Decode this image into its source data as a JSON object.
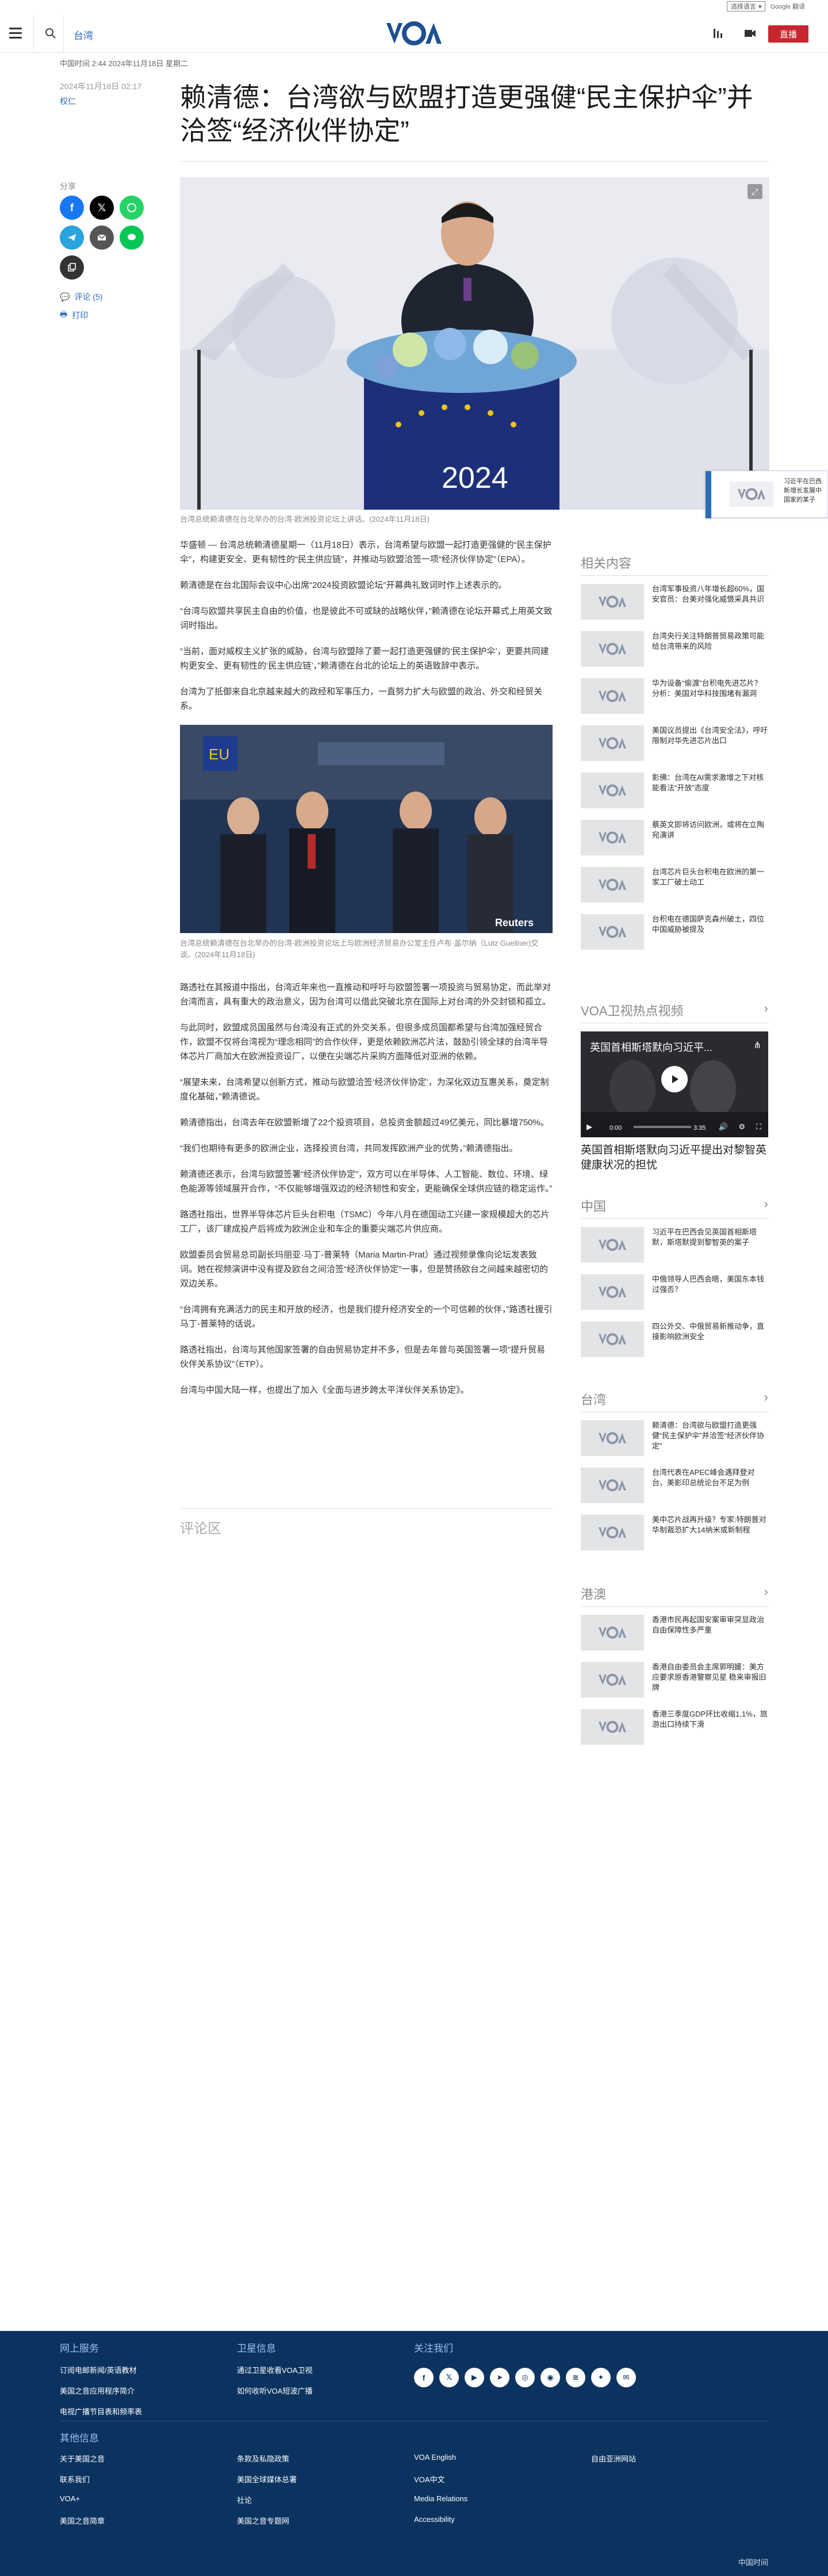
{
  "translate": {
    "select_label": "选择语言",
    "powered": "Google 翻译"
  },
  "header": {
    "section": "台湾",
    "live_label": "直播"
  },
  "article": {
    "dateline": "中国时间 2:44 2024年11月18日 星期二",
    "published": "2024年11月18日 02:17",
    "author": "权仁",
    "title": "赖清德：台湾欲与欧盟打造更强健“民主保护伞”并洽签“经济伙伴协定”",
    "hero_caption": "台湾总统赖清德在台北举办的台湾-欧洲投资论坛上讲话。(2024年11月18日)",
    "paragraphs_a": [
      "华盛顿 — 台湾总统赖清德星期一（11月18日）表示，台湾希望与欧盟一起打造更强健的“民主保护伞”，构建更安全、更有韧性的“民主供应链”，并推动与欧盟洽签一项“经济伙伴协定”（EPA）。",
      "赖清德是在台北国际会议中心出席“2024投资欧盟论坛”开幕典礼致词时作上述表示的。",
      "“台湾与欧盟共享民主自由的价值，也是彼此不可或缺的战略伙伴，”赖清德在论坛开幕式上用英文致词时指出。",
      "“当前，面对威权主义扩张的威胁，台湾与欧盟除了要一起打造更强健的‘民主保护伞’，更要共同建构更安全、更有韧性的‘民主供应链’，”赖清德在台北的论坛上的英语致辞中表示。",
      "台湾为了抵御来自北京越来越大的政经和军事压力，一直努力扩大与欧盟的政治、外交和经贸关系。"
    ],
    "inline_caption": "台湾总统赖清德在台北举办的台湾-欧洲投资论坛上与欧洲经济贸易办公室主任卢布·盖尔纳（Lutz Guellner)交谈。(2024年11月18日)",
    "paragraphs_b": [
      "路透社在其报道中指出，台湾近年来也一直推动和呼吁与欧盟签署一项投资与贸易协定，而此举对台湾而言，具有重大的政治意义，因为台湾可以借此突破北京在国际上对台湾的外交封锁和孤立。",
      "与此同时，欧盟成员国虽然与台湾没有正式的外交关系，但很多成员国都希望与台湾加强经贸合作，欧盟不仅将台湾视为“理念相同”的合作伙伴，更是依赖欧洲芯片法，鼓励引领全球的台湾半导体芯片厂商加大在欧洲投资设厂，以便在尖端芯片采购方面降低对亚洲的依赖。",
      "“展望未来，台湾希望以创新方式，推动与欧盟洽签‘经济伙伴协定’，为深化双边互惠关系，奠定制度化基础，”赖清德说。",
      "赖清德指出，台湾去年在欧盟新增了22个投资项目，总投资金额超过49亿美元，同比暴增750%。",
      "“我们也期待有更多的欧洲企业，选择投资台湾，共同发挥欧洲产业的优势，”赖清德指出。",
      "赖清德还表示，台湾与欧盟签署“经济伙伴协定”，双方可以在半导体、人工智能、数位、环境、绿色能源等领域展开合作，“不仅能够增强双边的经济韧性和安全，更能确保全球供应链的稳定运作。”",
      "路透社指出，世界半导体芯片巨头台积电（TSMC）今年八月在德国动工兴建一家规模超大的芯片工厂，该厂建成投产后将成为欧洲企业和车企的重要尖端芯片供应商。",
      "欧盟委员会贸易总司副长玛丽亚·马丁-普莱特（Maria Martin-Prat）通过视频录像向论坛发表致词。她在视频演讲中没有提及欧台之间洽签“经济伙伴协定”一事，但是赞扬欧台之间越来越密切的双边关系。",
      "“台湾拥有充满活力的民主和开放的经济，也是我们提升经济安全的一个可信赖的伙伴，”路透社援引马丁-普莱特的话说。",
      "路透社指出，台湾与其他国家签署的自由贸易协定并不多，但是去年曾与英国签署一项“提升贸易伙伴关系协议”（ETP）。",
      "台湾与中国大陆一样，也提出了加入《全面与进步跨太平洋伙伴关系协定》。"
    ],
    "comments_heading": "评论区"
  },
  "share": {
    "label": "分享",
    "comments_link": "评论 (5)",
    "print_link": "打印"
  },
  "widget": {
    "text": "习近平在巴西新增长发展中国家的某子"
  },
  "rail": {
    "related_heading": "相关内容",
    "related": [
      "台湾军事投资八年增长超60%，国安官员：台美对强化威慑采具共识",
      "台湾央行关注特朗普贸易政策可能给台湾带来的风险",
      "华为设备“偷渡”台积电先进芯片？分析：美国对华科技围堵有漏洞",
      "美国议员提出《台湾安全法》，呼吁限制对华先进芯片出口",
      "影佛：台湾在AI需求激增之下对核能看法“开放”态度",
      "蔡英文即将访问欧洲，或将在立陶宛演讲",
      "台湾芯片巨头台积电在欧洲的第一家工厂破土动工",
      "台积电在德国萨克森州破土，四位中国威胁被提及"
    ],
    "video_heading": "VOA卫视热点视频",
    "video_title": "英国首相斯塔默向习近平提出对黎智英健康状况的担忧",
    "video_overlay": "英国首相斯塔默向习近平...",
    "video_time": "0:00",
    "video_duration": "3:35",
    "china_heading": "中国",
    "china": [
      "习近平在巴西会见英国首相斯塔默，斯塔默提到黎智英的案子",
      "中俄领导人巴西会晤，美国东本钱过强否？",
      "四公外交、中俄贸易新推动争，直接影响欧洲安全"
    ],
    "taiwan_heading": "台湾",
    "taiwan": [
      "赖清德：台湾欲与欧盟打造更强健“民主保护伞”并洽签“经济伙伴协定”",
      "台湾代表在APEC峰会遇拜登对台，美影印总统论台不足为例",
      "美中芯片战再升级？专家:特朗普对华制裁恐扩大14纳米或新制程"
    ],
    "hk_heading": "港澳",
    "hk": [
      "香港市民再起国安案审审突显政治自由保障性多严重",
      "香港自由委员会主席郭明媛：美方应要求原香港警察见星 稳来审报旧牌",
      "香港三季度GDP环比收缩1.1%，旅游出口持续下滑"
    ]
  },
  "footer": {
    "col1_heading": "网上服务",
    "col1_links": [
      "订阅电邮新闻/英语教材",
      "美国之音应用程序简介",
      "电视广播节目表和频率表"
    ],
    "col2_heading": "卫星信息",
    "col2_links": [
      "通过卫星收看VOA卫视",
      "如何收听VOA短波广播"
    ],
    "col3_heading": "关注我们",
    "other_heading": "其他信息",
    "other_links": [
      [
        "关于美国之音",
        "条款及私隐政策",
        "VOA English",
        "自由亚洲网站"
      ],
      [
        "联系我们",
        "美国全球媒体总署",
        "VOA中文",
        ""
      ],
      [
        "VOA+",
        "社论",
        "Media Relations",
        ""
      ],
      [
        "美国之音简章",
        "美国之音专题网",
        "Accessibility",
        ""
      ]
    ],
    "copyright": "中国时间"
  }
}
